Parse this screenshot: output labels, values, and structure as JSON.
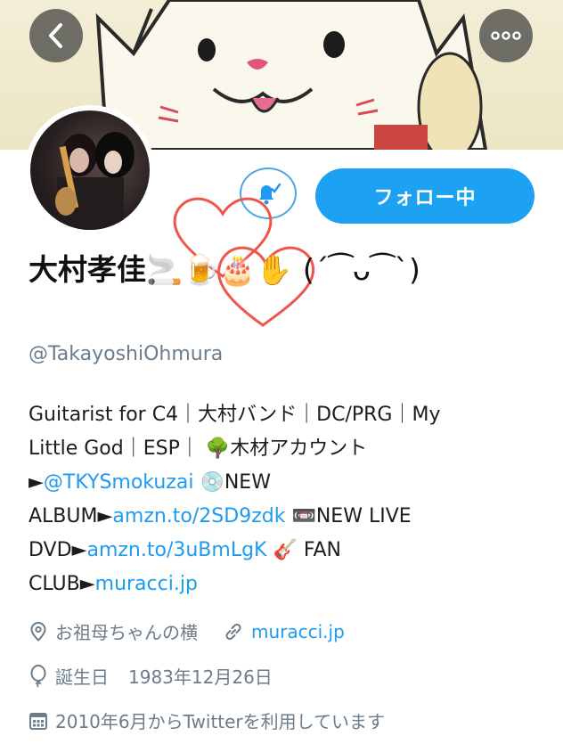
{
  "header": {
    "back_icon": "chevron-left-icon",
    "more_icon": "more-horizontal-icon"
  },
  "profile": {
    "name": "大村孝佳",
    "name_emoji": "🚬🍺🎂✋",
    "name_face": "(´⁀ᴗ⁀`)",
    "handle": "@TakayoshiOhmura",
    "follow_label": "フォロー中",
    "notify_icon": "bell-check-icon"
  },
  "bio": {
    "line1": "Guitarist for C4｜大村バンド｜DC/PRG｜My",
    "line2": "Little God｜ESP｜ 🌳木材アカウント",
    "line3_prefix": "►",
    "line3_link": "@TKYSmokuzai",
    "line3_suffix": " 💿NEW",
    "line4_prefix": "ALBUM►",
    "line4_link": "amzn.to/2SD9zdk",
    "line4_suffix": " 📼NEW LIVE",
    "line5_prefix": "DVD►",
    "line5_link": "amzn.to/3uBmLgK",
    "line5_suffix": " 🎸 FAN",
    "line6_prefix": "CLUB►",
    "line6_link": "muracci.jp"
  },
  "meta": {
    "location": "お祖母ちゃんの横",
    "website": "muracci.jp",
    "birthday_label": "誕生日",
    "birthday_value": "1983年12月26日",
    "joined": "2010年6月からTwitterを利用しています"
  },
  "colors": {
    "accent": "#1da1f2",
    "link": "#1d9bf0",
    "muted": "#6b7c8b",
    "heart": "#f0554a"
  }
}
